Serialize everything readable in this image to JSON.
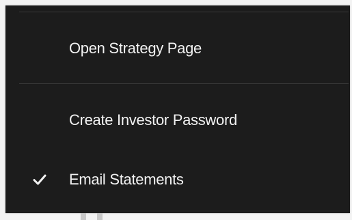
{
  "menu": {
    "items": [
      {
        "label": "Open Strategy Page",
        "checked": false
      },
      {
        "label": "Create Investor Password",
        "checked": false
      },
      {
        "label": "Email Statements",
        "checked": true
      }
    ],
    "check_icon": "checkmark-icon",
    "colors": {
      "background": "#1c1c1c",
      "text": "#f2f2f2",
      "divider": "#3a3a3a"
    }
  }
}
